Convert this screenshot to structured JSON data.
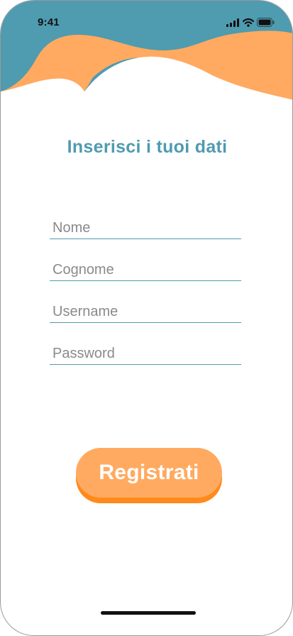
{
  "status_bar": {
    "time": "9:41",
    "icons": [
      "cellular-signal-icon",
      "wifi-icon",
      "battery-icon"
    ]
  },
  "colors": {
    "header_teal": "#4f9bb0",
    "header_orange": "#ffaa60",
    "button_orange": "#ffaa60",
    "button_shadow_orange": "#ff8a1c",
    "field_underline": "#4f9bb0",
    "title_color": "#4f9bb0"
  },
  "form": {
    "title": "Inserisci i tuoi dati",
    "fields": [
      {
        "placeholder": "Nome",
        "value": ""
      },
      {
        "placeholder": "Cognome",
        "value": ""
      },
      {
        "placeholder": "Username",
        "value": ""
      },
      {
        "placeholder": "Password",
        "value": ""
      }
    ],
    "submit_label": "Registrati"
  }
}
